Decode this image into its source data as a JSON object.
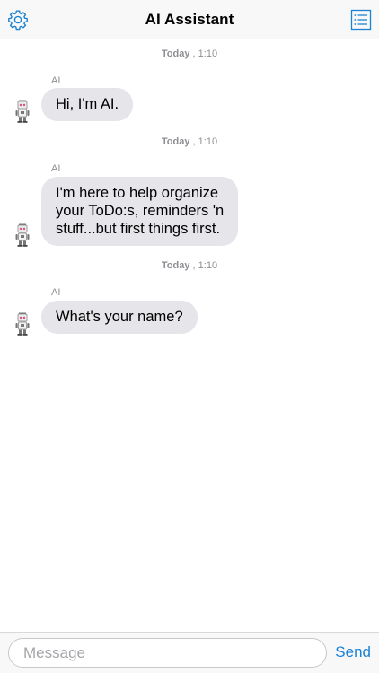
{
  "header": {
    "title": "AI Assistant",
    "left_icon": "gear-icon",
    "right_icon": "list-icon",
    "accent_color": "#1a82d4"
  },
  "messages": [
    {
      "timestamp_day": "Today",
      "timestamp_sep": ",",
      "timestamp_time": "1:10",
      "sender": "AI",
      "lines": [
        "Hi, I'm AI."
      ]
    },
    {
      "timestamp_day": "Today",
      "timestamp_sep": ",",
      "timestamp_time": "1:10",
      "sender": "AI",
      "lines": [
        "I'm here to help organize",
        "your ToDo:s, reminders 'n",
        "stuff...but first things first."
      ]
    },
    {
      "timestamp_day": "Today",
      "timestamp_sep": ",",
      "timestamp_time": "1:10",
      "sender": "AI",
      "lines": [
        "What's your name?"
      ]
    }
  ],
  "composer": {
    "value": "",
    "placeholder": "Message",
    "send_label": "Send"
  },
  "colors": {
    "incoming_bubble": "#e5e5ea",
    "meta_text": "#8e8e93",
    "bar_background": "#f8f8f8"
  }
}
